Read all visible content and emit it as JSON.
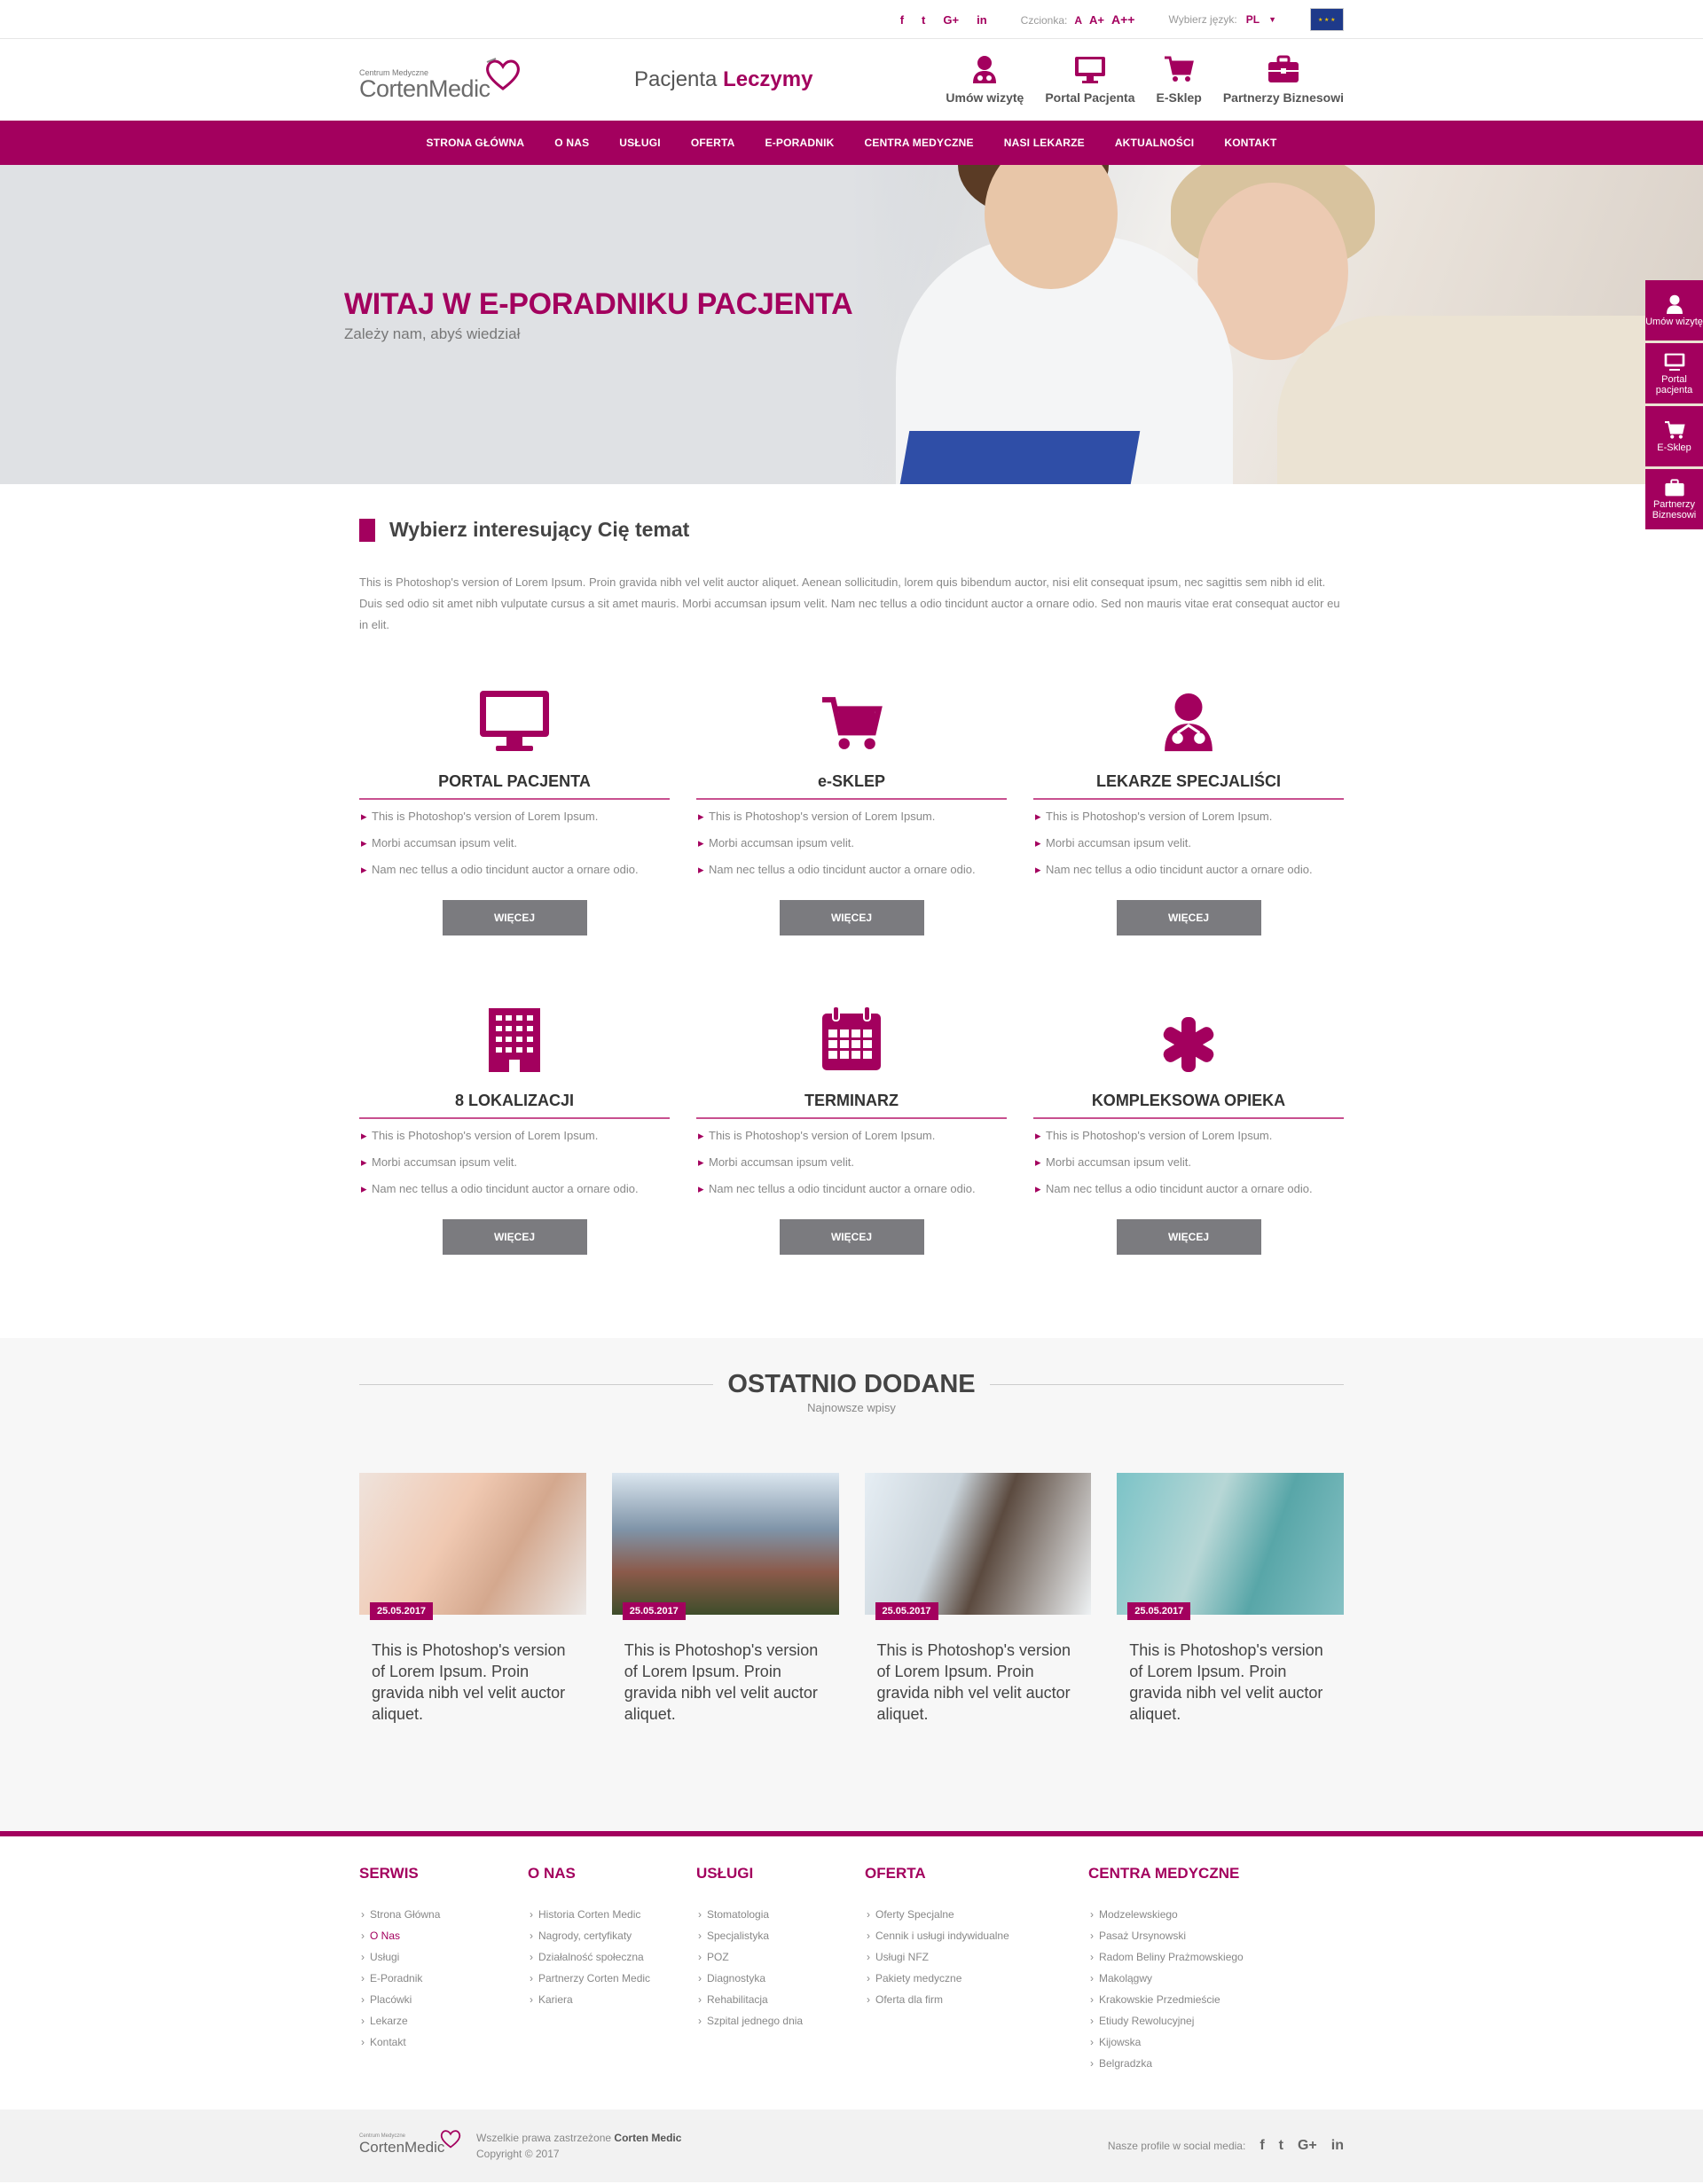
{
  "topbar": {
    "social": [
      "f",
      "t",
      "G+",
      "in"
    ],
    "font_label": "Czcionka:",
    "font_sizes": [
      "A",
      "A+",
      "A++"
    ],
    "lang_label": "Wybierz język:",
    "lang_value": "PL"
  },
  "header": {
    "logo_small": "Centrum Medyczne",
    "logo_big": "CortenMedic",
    "slogan_1": "Pacjenta",
    "slogan_2": "Leczymy",
    "links": [
      "Umów wizytę",
      "Portal Pacjenta",
      "E-Sklep",
      "Partnerzy Biznesowi"
    ]
  },
  "nav": [
    "STRONA GŁÓWNA",
    "O NAS",
    "USŁUGI",
    "OFERTA",
    "E-PORADNIK",
    "CENTRA MEDYCZNE",
    "NASI LEKARZE",
    "AKTUALNOŚCI",
    "KONTAKT"
  ],
  "hero": {
    "title": "WITAJ W E-PORADNIKU PACJENTA",
    "subtitle": "Zależy nam, abyś wiedział"
  },
  "side_tabs": [
    "Umów wizytę",
    "Portal pacjenta",
    "E-Sklep",
    "Partnerzy Biznesowi"
  ],
  "topics": {
    "title": "Wybierz interesujący Cię temat",
    "intro": "This is Photoshop's version  of Lorem Ipsum. Proin gravida nibh vel velit auctor aliquet. Aenean sollicitudin, lorem quis bibendum auctor, nisi elit consequat ipsum, nec sagittis sem nibh id elit. Duis sed odio sit amet nibh vulputate cursus a sit amet mauris. Morbi accumsan ipsum velit. Nam nec tellus a odio tincidunt auctor a ornare odio. Sed non  mauris vitae erat consequat auctor eu in elit.",
    "cards": [
      {
        "icon": "monitor-icon",
        "title": "PORTAL PACJENTA",
        "items": [
          "This is Photoshop's version  of Lorem Ipsum.",
          "Morbi accumsan ipsum velit.",
          "Nam nec tellus a odio tincidunt auctor a ornare odio."
        ],
        "button": "WIĘCEJ"
      },
      {
        "icon": "cart-icon",
        "title": "e-SKLEP",
        "items": [
          "This is Photoshop's version  of Lorem Ipsum.",
          "Morbi accumsan ipsum velit.",
          "Nam nec tellus a odio tincidunt auctor a ornare odio."
        ],
        "button": "WIĘCEJ"
      },
      {
        "icon": "doctor-icon",
        "title": "LEKARZE SPECJALIŚCI",
        "items": [
          "This is Photoshop's version  of Lorem Ipsum.",
          "Morbi accumsan ipsum velit.",
          "Nam nec tellus a odio tincidunt auctor a ornare odio."
        ],
        "button": "WIĘCEJ"
      },
      {
        "icon": "building-icon",
        "title": "8 LOKALIZACJI",
        "items": [
          "This is Photoshop's version  of Lorem Ipsum.",
          "Morbi accumsan ipsum velit.",
          "Nam nec tellus a odio tincidunt auctor a ornare odio."
        ],
        "button": "WIĘCEJ"
      },
      {
        "icon": "calendar-icon",
        "title": "TERMINARZ",
        "items": [
          "This is Photoshop's version  of Lorem Ipsum.",
          "Morbi accumsan ipsum velit.",
          "Nam nec tellus a odio tincidunt auctor a ornare odio."
        ],
        "button": "WIĘCEJ"
      },
      {
        "icon": "asterisk-icon",
        "title": "KOMPLEKSOWA OPIEKA",
        "items": [
          "This is Photoshop's version  of Lorem Ipsum.",
          "Morbi accumsan ipsum velit.",
          "Nam nec tellus a odio tincidunt auctor a ornare odio."
        ],
        "button": "WIĘCEJ"
      }
    ]
  },
  "recent": {
    "title": "OSTATNIO DODANE",
    "subtitle": "Najnowsze wpisy",
    "posts": [
      {
        "date": "25.05.2017",
        "text": "This is Photoshop's version  of Lorem Ipsum. Proin gravida nibh vel velit auctor aliquet."
      },
      {
        "date": "25.05.2017",
        "text": "This is Photoshop's version  of Lorem Ipsum. Proin gravida nibh vel velit auctor aliquet."
      },
      {
        "date": "25.05.2017",
        "text": "This is Photoshop's version  of Lorem Ipsum. Proin gravida nibh vel velit auctor aliquet."
      },
      {
        "date": "25.05.2017",
        "text": "This is Photoshop's version  of Lorem Ipsum. Proin gravida nibh vel velit auctor aliquet."
      }
    ]
  },
  "footer": {
    "columns": [
      {
        "title": "SERWIS",
        "items": [
          "Strona Główna",
          "O Nas",
          "Usługi",
          "E-Poradnik",
          "Placówki",
          "Lekarze",
          "Kontakt"
        ]
      },
      {
        "title": "O NAS",
        "items": [
          "Historia Corten Medic",
          "Nagrody, certyfikaty",
          "Działalność społeczna",
          "Partnerzy Corten Medic",
          "Kariera"
        ]
      },
      {
        "title": "USŁUGI",
        "items": [
          "Stomatologia",
          "Specjalistyka",
          "POZ",
          "Diagnostyka",
          "Rehabilitacja",
          "Szpital jednego dnia"
        ]
      },
      {
        "title": "OFERTA",
        "items": [
          "Oferty Specjalne",
          "Cennik i usługi indywidualne",
          "Usługi NFZ",
          "Pakiety medyczne",
          "Oferta dla firm"
        ]
      },
      {
        "title": "CENTRA MEDYCZNE",
        "items": [
          "Modzelewskiego",
          "Pasaż Ursynowski",
          "Radom Beliny Prażmowskiego",
          "Makolągwy",
          "Krakowskie Przedmieście",
          "Etiudy Rewolucyjnej",
          "Kijowska",
          "Belgradzka"
        ]
      }
    ],
    "copyright_prefix": "Wszelkie prawa zastrzeżone",
    "copyright_brand": "Corten Medic",
    "copyright_year": "Copyright © 2017",
    "social_label": "Nasze profile w social media:",
    "social": [
      "f",
      "t",
      "G+",
      "in"
    ]
  },
  "colors": {
    "accent": "#a3005e",
    "button": "#7b7b7f"
  }
}
